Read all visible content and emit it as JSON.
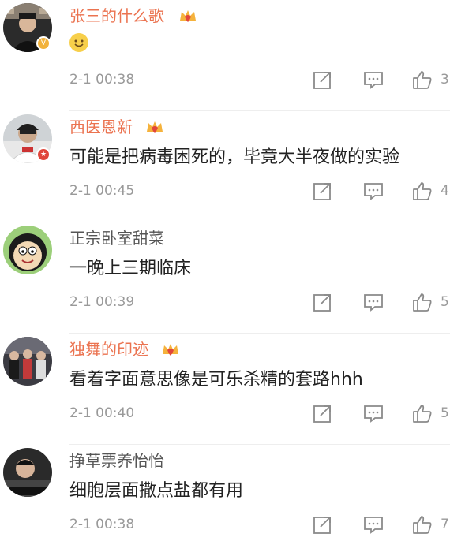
{
  "comments": [
    {
      "username": "张三的什么歌",
      "username_style": "orange",
      "has_crown": true,
      "text": "",
      "text_is_emoji": true,
      "time": "2-1 00:38",
      "likes": "3",
      "badge": "gold"
    },
    {
      "username": "西医恩新",
      "username_style": "orange",
      "has_crown": true,
      "text": "可能是把病毒困死的，毕竟大半夜做的实验",
      "time": "2-1 00:45",
      "likes": "4",
      "badge": "red"
    },
    {
      "username": "正宗卧室甜菜",
      "username_style": "gray",
      "has_crown": false,
      "text": "一晚上三期临床",
      "time": "2-1 00:39",
      "likes": "5"
    },
    {
      "username": "独舞的印迹",
      "username_style": "orange",
      "has_crown": true,
      "text": "看着字面意思像是可乐杀精的套路hhh",
      "time": "2-1 00:40",
      "likes": "5"
    },
    {
      "username": "挣草票养怡怡",
      "username_style": "gray",
      "has_crown": false,
      "text": "细胞层面撒点盐都有用",
      "time": "2-1 00:38",
      "likes": "7"
    }
  ],
  "icons": {
    "share": "share-icon",
    "comment": "comment-icon",
    "like": "thumbs-up-icon",
    "crown": "crown-badge-icon"
  },
  "colors": {
    "username_orange": "#eb7350",
    "timestamp_gray": "#999999",
    "icon_gray": "#8a8a8a"
  }
}
